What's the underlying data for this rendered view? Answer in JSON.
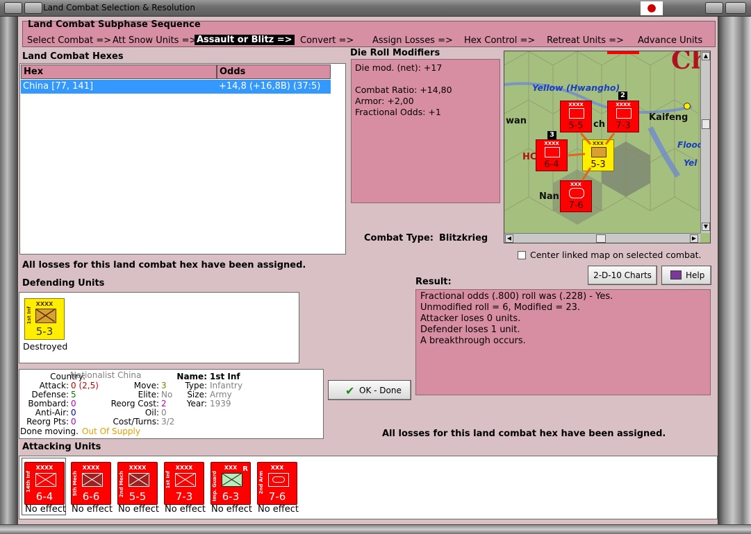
{
  "window": {
    "title": "Land Combat Selection & Resolution"
  },
  "subphase": {
    "heading": "Land Combat Subphase Sequence",
    "steps": [
      "Select Combat =>",
      "Att Snow Units =>",
      "Assault or Blitz =>",
      "Convert =>",
      "Assign Losses =>",
      "Hex Control =>",
      "Retreat Units =>",
      "Advance Units"
    ]
  },
  "hexes": {
    "heading": "Land Combat Hexes",
    "col_hex": "Hex",
    "col_odds": "Odds",
    "rows": [
      {
        "hex": "China [77, 141]",
        "odds": "+14,8 (+16,8B) (37:5)"
      }
    ]
  },
  "modifiers": {
    "heading": "Die Roll Modifiers",
    "net": "Die mod. (net): +17",
    "ratio": "Combat Ratio: +14,80",
    "armor": "Armor: +2,00",
    "fractional": "Fractional Odds: +1"
  },
  "combat_type": {
    "label": "Combat Type:",
    "value": "Blitzkrieg"
  },
  "map": {
    "labels": [
      "Yellow (Hwangho)",
      "Kaifeng",
      "Flood",
      "Yel",
      "wan",
      "ch",
      "HC",
      "Nan",
      "Ch"
    ],
    "units": [
      {
        "name": "5-5",
        "stack": ""
      },
      {
        "name": "7-3",
        "stack": "2"
      },
      {
        "name": "6-4",
        "stack": "3"
      },
      {
        "name": "5-3",
        "stack": ""
      },
      {
        "name": "7-6",
        "stack": ""
      }
    ],
    "center_linked": "Center linked map on selected combat."
  },
  "losses_assigned_top": "All losses for this land combat hex have been assigned.",
  "defending": {
    "heading": "Defending Units",
    "units": [
      {
        "size": "XXXX",
        "name": "1st Inf",
        "strength": "5-3",
        "status": "Destroyed",
        "color": "#ffee00"
      }
    ]
  },
  "buttons": {
    "charts": "2-D-10 Charts",
    "help": "Help",
    "ok": "OK - Done"
  },
  "result": {
    "heading": "Result:",
    "lines": [
      "Fractional odds (.800) roll was (.228)  - Yes.",
      "Unmodified roll = 6, Modified = 23.",
      "Attacker loses 0 units.",
      "Defender loses 1 unit.",
      "A breakthrough occurs."
    ]
  },
  "info": {
    "country_label": "Country:",
    "country": "Nationalist China",
    "attack_label": "Attack:",
    "attack": "0",
    "attack_extra": "(2,5)",
    "defense_label": "Defense:",
    "defense": "5",
    "bombard_label": "Bombard:",
    "bombard": "0",
    "antiair_label": "Anti-Air:",
    "antiair": "0",
    "reorg_label": "Reorg Pts:",
    "reorg": "0",
    "move_label": "Move:",
    "move": "3",
    "elite_label": "Elite:",
    "elite": "No",
    "reorgcost_label": "Reorg Cost:",
    "reorgcost": "2",
    "oil_label": "Oil:",
    "oil": "0",
    "costturns_label": "Cost/Turns:",
    "costturns": "3/2",
    "name_label": "Name:",
    "name": "1st Inf",
    "type_label": "Type:",
    "type": "Infantry",
    "size_label": "Size:",
    "size": "Army",
    "year_label": "Year:",
    "year": "1939",
    "done_label": "Done moving.",
    "supply": "Out Of Supply"
  },
  "losses_assigned_bottom": "All losses for this land combat hex have been assigned.",
  "attacking": {
    "heading": "Attacking Units",
    "units": [
      {
        "size": "XXXX",
        "name": "14th Inf",
        "strength": "6-4",
        "effect": "No effect"
      },
      {
        "size": "XXXX",
        "name": "5th Mech",
        "strength": "6-6",
        "effect": "No effect"
      },
      {
        "size": "XXXX",
        "name": "2nd Mech",
        "strength": "5-5",
        "effect": "No effect"
      },
      {
        "size": "XXXX",
        "name": "1st Inf",
        "strength": "7-3",
        "effect": "No effect"
      },
      {
        "size": "XXX",
        "name": "Imp. Guard",
        "strength": "6-3",
        "effect": "No effect",
        "badge": "R"
      },
      {
        "size": "XXX",
        "name": "2nd Arm",
        "strength": "7-6",
        "effect": "No effect"
      }
    ]
  },
  "colors": {
    "pink_panel": "#d88ea2",
    "unit_red": "#ff0000",
    "unit_yellow": "#ffee00",
    "selection": "#3399ff",
    "attack_red": "#d00000",
    "defense_green": "#008000",
    "supply_orange": "#e0a000"
  }
}
